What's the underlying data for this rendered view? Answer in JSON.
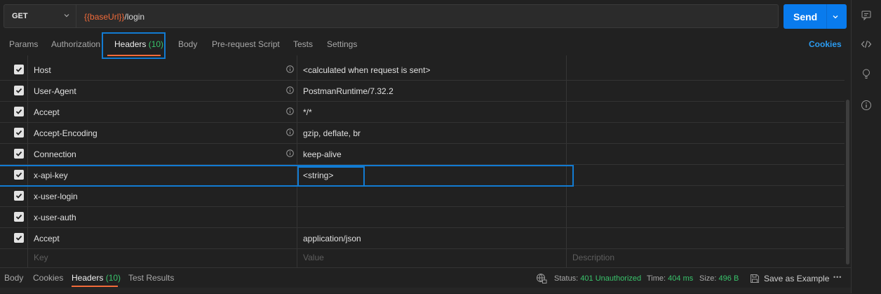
{
  "request": {
    "method": "GET",
    "url_variable": "{{baseUrl}}",
    "url_path": "/login",
    "send_label": "Send"
  },
  "tabs": [
    {
      "label": "Params"
    },
    {
      "label": "Authorization"
    },
    {
      "label": "Headers",
      "count": "(10)"
    },
    {
      "label": "Body"
    },
    {
      "label": "Pre-request Script"
    },
    {
      "label": "Tests"
    },
    {
      "label": "Settings"
    }
  ],
  "cookies_link": "Cookies",
  "headers": [
    {
      "key": "Host",
      "value": "<calculated when request is sent>",
      "info": true,
      "checked": true
    },
    {
      "key": "User-Agent",
      "value": "PostmanRuntime/7.32.2",
      "info": true,
      "checked": true
    },
    {
      "key": "Accept",
      "value": "*/*",
      "info": true,
      "checked": true
    },
    {
      "key": "Accept-Encoding",
      "value": "gzip, deflate, br",
      "info": true,
      "checked": true
    },
    {
      "key": "Connection",
      "value": "keep-alive",
      "info": true,
      "checked": true
    },
    {
      "key": "x-api-key",
      "value": "<string>",
      "info": false,
      "checked": true
    },
    {
      "key": "x-user-login",
      "value": "",
      "info": false,
      "checked": true
    },
    {
      "key": "x-user-auth",
      "value": "",
      "info": false,
      "checked": true
    },
    {
      "key": "Accept",
      "value": "application/json",
      "info": false,
      "checked": true
    }
  ],
  "placeholders": {
    "key": "Key",
    "value": "Value",
    "description": "Description"
  },
  "response": {
    "tabs": [
      {
        "label": "Body"
      },
      {
        "label": "Cookies"
      },
      {
        "label": "Headers",
        "count": "(10)"
      },
      {
        "label": "Test Results"
      }
    ],
    "status_label": "Status:",
    "status_value": "401 Unauthorized",
    "time_label": "Time:",
    "time_value": "404 ms",
    "size_label": "Size:",
    "size_value": "496 B",
    "save_label": "Save as Example",
    "more": "•••"
  },
  "colors": {
    "accent": "#f26b3a",
    "send": "#097bed",
    "count": "#39c36b",
    "highlight": "#127bd2"
  }
}
